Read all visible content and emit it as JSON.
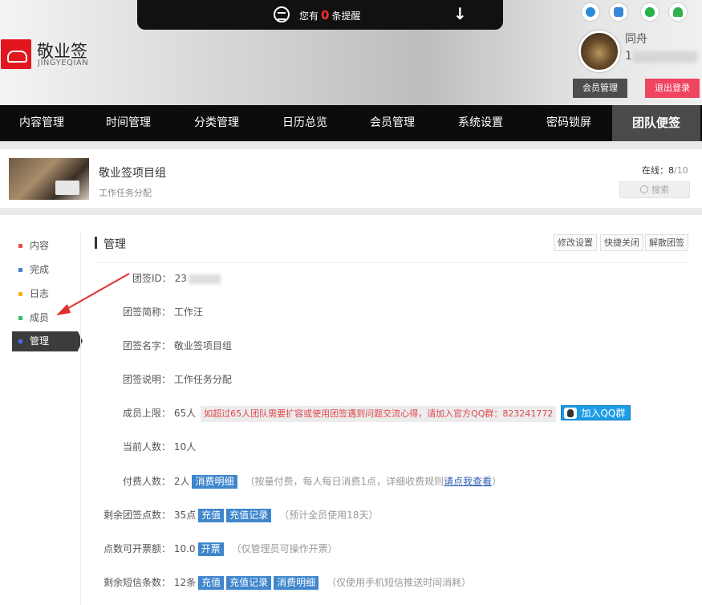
{
  "notice": {
    "prefix": "您有",
    "count": "0",
    "suffix": "条提醒"
  },
  "brand": {
    "name": "敬业签",
    "sub": "JINGYEQIAN"
  },
  "user": {
    "name": "同舟",
    "id_visible": "1"
  },
  "header_buttons": {
    "member": "会员管理",
    "logout": "退出登录"
  },
  "platform_icons": [
    "ie-icon",
    "windows-icon",
    "apple-icon",
    "android-icon"
  ],
  "nav": [
    "内容管理",
    "时间管理",
    "分类管理",
    "日历总览",
    "会员管理",
    "系统设置",
    "密码锁屏",
    "团队便签"
  ],
  "group": {
    "name": "敬业签项目组",
    "desc": "工作任务分配",
    "online_label": "在线：",
    "online_now": "8",
    "online_total": "/10",
    "search": "搜索"
  },
  "sidebar": [
    {
      "label": "内容",
      "color": "#e5534b"
    },
    {
      "label": "完成",
      "color": "#3f86cc"
    },
    {
      "label": "日志",
      "color": "#f2b01e"
    },
    {
      "label": "成员",
      "color": "#2fbf71"
    },
    {
      "label": "管理",
      "color": "#4a6cf0"
    }
  ],
  "panel": {
    "title": "管理",
    "buttons": [
      "修改设置",
      "快捷关闭",
      "解散团签"
    ]
  },
  "fields": {
    "id_label": "团签ID：",
    "id_value": "23",
    "short_label": "团签简称：",
    "short_value": "工作汪",
    "name_label": "团签名字：",
    "name_value": "敬业签项目组",
    "desc_label": "团签说明：",
    "desc_value": "工作任务分配",
    "limit_label": "成员上限：",
    "limit_value": "65人",
    "limit_warn": "如超过65人团队需要扩容或使用团签遇到问题交流心得，请加入官方QQ群：823241772",
    "qq_button": "加入QQ群",
    "current_label": "当前人数：",
    "current_value": "10人",
    "paid_label": "付费人数：",
    "paid_value": "2人",
    "paid_tag": "消费明细",
    "paid_note_pre": "（按量付费，每人每日消费1点，详细收费规则",
    "paid_note_link": "请点我查看",
    "paid_note_post": "）",
    "points_label": "剩余团签点数：",
    "points_value": "35点",
    "points_tag1": "充值",
    "points_tag2": "充值记录",
    "points_note": "（预计全员使用18天）",
    "invoice_label": "点数可开票额：",
    "invoice_value": "10.0",
    "invoice_tag": "开票",
    "invoice_note": "（仅管理员可操作开票）",
    "sms_label": "剩余短信条数：",
    "sms_value": "12条",
    "sms_tag1": "充值",
    "sms_tag2": "充值记录",
    "sms_tag3": "消费明细",
    "sms_note": "（仅使用手机短信推送时间消耗）"
  }
}
